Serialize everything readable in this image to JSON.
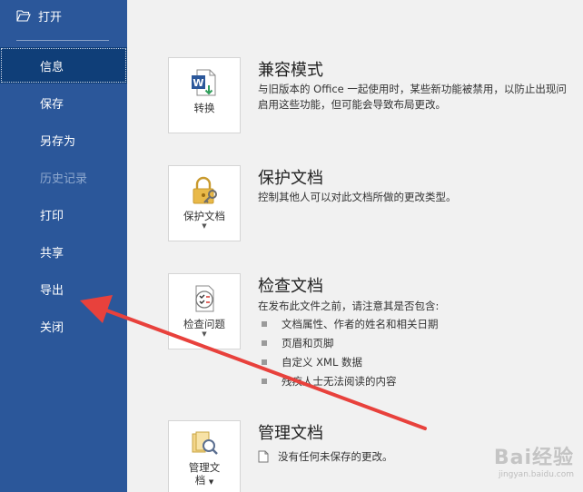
{
  "sidebar": {
    "open_label": "打开",
    "items": [
      {
        "label": "信息",
        "state": "selected"
      },
      {
        "label": "保存",
        "state": "normal"
      },
      {
        "label": "另存为",
        "state": "normal"
      },
      {
        "label": "历史记录",
        "state": "disabled"
      },
      {
        "label": "打印",
        "state": "normal"
      },
      {
        "label": "共享",
        "state": "normal"
      },
      {
        "label": "导出",
        "state": "normal"
      },
      {
        "label": "关闭",
        "state": "normal"
      }
    ]
  },
  "sections": {
    "compat": {
      "button_label": "转换",
      "title": "兼容模式",
      "desc_line1": "与旧版本的 Office 一起使用时，某些新功能被禁用，以防止出现问",
      "desc_line2": "启用这些功能，但可能会导致布局更改。"
    },
    "protect": {
      "button_label": "保护文档",
      "title": "保护文档",
      "desc": "控制其他人可以对此文档所做的更改类型。"
    },
    "inspect": {
      "button_label": "检查问题",
      "title": "检查文档",
      "desc": "在发布此文件之前，请注意其是否包含:",
      "bullets": [
        "文档属性、作者的姓名和相关日期",
        "页眉和页脚",
        "自定义 XML 数据",
        "残疾人士无法阅读的内容"
      ]
    },
    "manage": {
      "button_label_line1": "管理文",
      "button_label_line2": "档",
      "title": "管理文档",
      "note": "没有任何未保存的更改。"
    }
  },
  "watermark": {
    "main": "Bai经验",
    "sub": "jingyan.baidu.com"
  },
  "colors": {
    "sidebar": "#2b579a",
    "selected": "#0f3e78",
    "arrow": "#e8413c",
    "content_bg": "#f1f1f1"
  }
}
